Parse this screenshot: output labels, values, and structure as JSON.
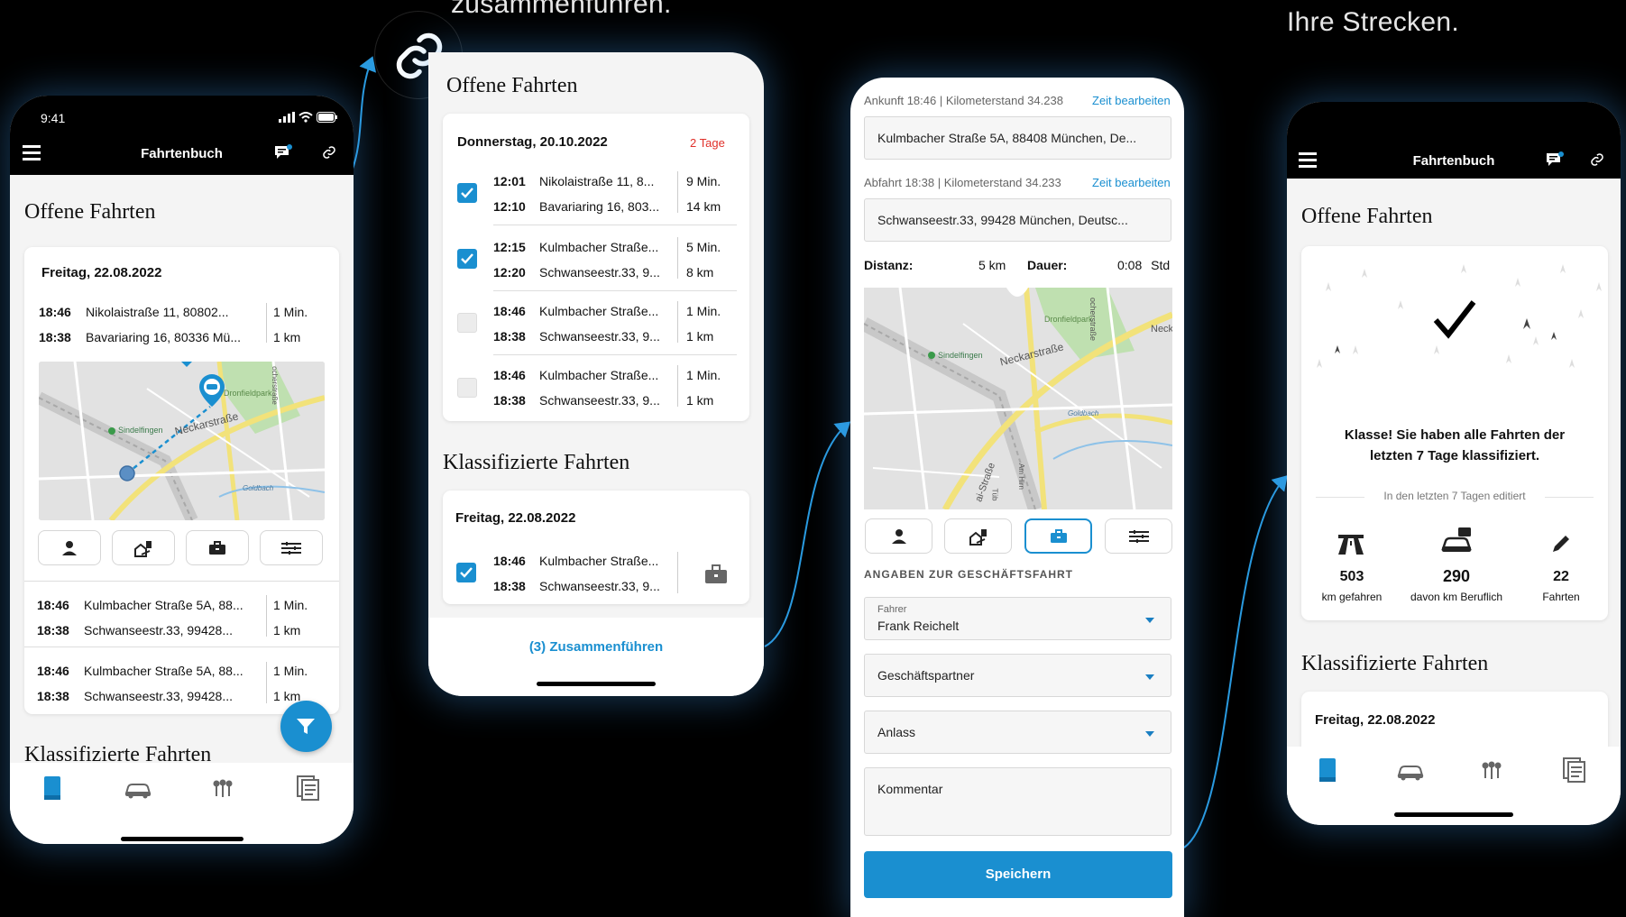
{
  "captions": {
    "merge": "zusammenführen.",
    "routes": "Ihre Strecken."
  },
  "colors": {
    "accent": "#1a8fd0",
    "alert": "#e0302a",
    "background": "#000000"
  },
  "phone1": {
    "status_time": "9:41",
    "title": "Fahrtenbuch",
    "section_open": "Offene Fahrten",
    "card_date": "Freitag, 22.08.2022",
    "trip_top": [
      {
        "time": "18:46",
        "addr": "Nikolaistraße 11, 80802...",
        "meta": "1 Min."
      },
      {
        "time": "18:38",
        "addr": "Bavariaring 16, 80336 Mü...",
        "meta": "1 km"
      }
    ],
    "map_labels": {
      "park": "Dronfieldpark",
      "street": "Neckarstraße",
      "station": "Sindelfingen",
      "river": "Goldbach",
      "street2": "ocherstraße"
    },
    "trips": [
      [
        {
          "time": "18:46",
          "addr": "Kulmbacher Straße 5A, 88...",
          "meta": "1 Min."
        },
        {
          "time": "18:38",
          "addr": "Schwanseestr.33, 99428...",
          "meta": "1 km"
        }
      ],
      [
        {
          "time": "18:46",
          "addr": "Kulmbacher Straße 5A, 88...",
          "meta": "1 Min."
        },
        {
          "time": "18:38",
          "addr": "Schwanseestr.33, 99428...",
          "meta": "1 km"
        }
      ]
    ],
    "section_classified": "Klassifizierte Fahrten",
    "icons": [
      "menu-icon",
      "chat-icon",
      "link-icon",
      "logbook-icon",
      "car-icon",
      "pins-icon",
      "documents-icon",
      "filter-icon"
    ]
  },
  "phone2": {
    "section_open": "Offene Fahrten",
    "day_label": "Donnerstag, 20.10.2022",
    "days_badge": "2 Tage",
    "trips": [
      {
        "checked": true,
        "rows": [
          {
            "time": "12:01",
            "addr": "Nikolaistraße 11, 8...",
            "meta": "9 Min."
          },
          {
            "time": "12:10",
            "addr": "Bavariaring 16, 803...",
            "meta": "14 km"
          }
        ]
      },
      {
        "checked": true,
        "rows": [
          {
            "time": "12:15",
            "addr": "Kulmbacher Straße...",
            "meta": "5 Min."
          },
          {
            "time": "12:20",
            "addr": "Schwanseestr.33, 9...",
            "meta": "8 km"
          }
        ]
      },
      {
        "checked": false,
        "rows": [
          {
            "time": "18:46",
            "addr": "Kulmbacher Straße...",
            "meta": "1 Min."
          },
          {
            "time": "18:38",
            "addr": "Schwanseestr.33, 9...",
            "meta": "1 km"
          }
        ]
      },
      {
        "checked": false,
        "rows": [
          {
            "time": "18:46",
            "addr": "Kulmbacher Straße...",
            "meta": "1 Min."
          },
          {
            "time": "18:38",
            "addr": "Schwanseestr.33, 9...",
            "meta": "1 km"
          }
        ]
      }
    ],
    "section_classified": "Klassifizierte Fahrten",
    "classified_date": "Freitag, 22.08.2022",
    "classified_rows": [
      {
        "time": "18:46",
        "addr": "Kulmbacher Straße..."
      },
      {
        "time": "18:38",
        "addr": "Schwanseestr.33, 9..."
      }
    ],
    "merge_button": "(3) Zusammenführen"
  },
  "phone3": {
    "arrival": "Ankunft 18:46",
    "arrival_km": "Kilometerstand 34.238",
    "edit_time": "Zeit bearbeiten",
    "arrival_address": "Kulmbacher Straße 5A, 88408 München, De...",
    "departure": "Abfahrt 18:38",
    "departure_km": "Kilometerstand 34.233",
    "departure_address": "Schwanseestr.33, 99428 München, Deutsc...",
    "distance_label": "Distanz:",
    "distance_value": "5 km",
    "duration_label": "Dauer:",
    "duration_value": "0:08",
    "duration_unit": "Std",
    "map_labels": {
      "park": "Dronfieldpark",
      "street": "Neckarstraße",
      "station": "Sindelfingen",
      "river": "Goldbach",
      "street2": "ocherstraße",
      "street3": "Neck",
      "street4": "ai-Straße",
      "street5": "Am Hirn",
      "street6": "Tüb"
    },
    "section_business": "ANGABEN ZUR GESCHÄFTSFAHRT",
    "driver_label": "Fahrer",
    "driver_value": "Frank Reichelt",
    "partner_label": "Geschäftspartner",
    "occasion_label": "Anlass",
    "comment_label": "Kommentar",
    "save_button": "Speichern"
  },
  "phone4": {
    "title": "Fahrtenbuch",
    "section_open": "Offene Fahrten",
    "success_message": "Klasse! Sie haben alle Fahrten der letzten 7 Tage klassifiziert.",
    "edited_label": "In den letzten 7 Tagen editiert",
    "stats": [
      {
        "value": "503",
        "label": "km gefahren"
      },
      {
        "value": "290",
        "label": "davon km Beruflich"
      },
      {
        "value": "22",
        "label": "Fahrten"
      }
    ],
    "section_classified": "Klassifizierte Fahrten",
    "classified_date": "Freitag, 22.08.2022"
  }
}
